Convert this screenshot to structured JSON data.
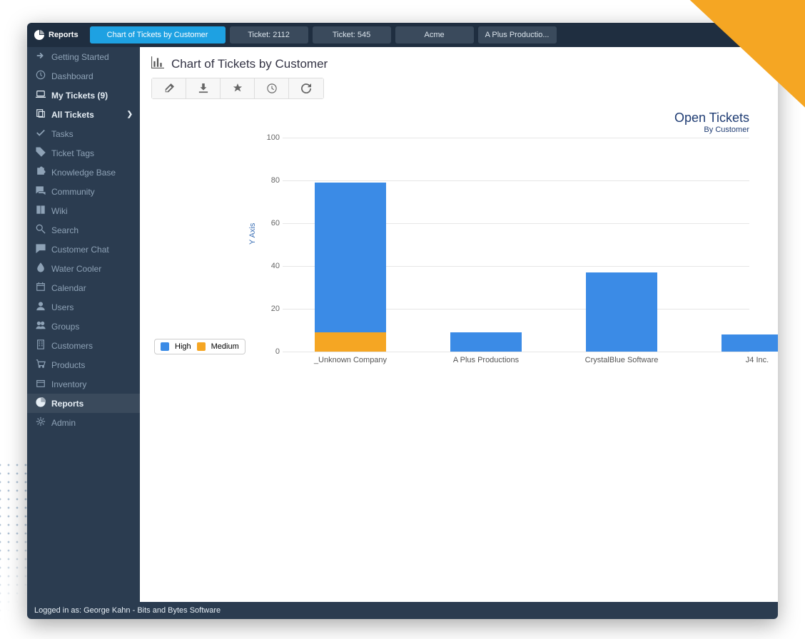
{
  "tabs": [
    {
      "label": "Reports",
      "kind": "main"
    },
    {
      "label": "Chart of Tickets by Customer",
      "active": true
    },
    {
      "label": "Ticket: 2112"
    },
    {
      "label": "Ticket: 545"
    },
    {
      "label": "Acme"
    },
    {
      "label": "A Plus Productio..."
    }
  ],
  "sidebar": {
    "items": [
      {
        "label": "Getting Started",
        "icon": "arrow-right"
      },
      {
        "label": "Dashboard",
        "icon": "clock"
      },
      {
        "label": "My Tickets (9)",
        "icon": "laptop",
        "highlighted": true
      },
      {
        "label": "All Tickets",
        "icon": "copy",
        "highlighted": true,
        "expand": true
      },
      {
        "label": "Tasks",
        "icon": "check"
      },
      {
        "label": "Ticket Tags",
        "icon": "tag"
      },
      {
        "label": "Knowledge Base",
        "icon": "puzzle"
      },
      {
        "label": "Community",
        "icon": "comments"
      },
      {
        "label": "Wiki",
        "icon": "book"
      },
      {
        "label": "Search",
        "icon": "search"
      },
      {
        "label": "Customer Chat",
        "icon": "chat"
      },
      {
        "label": "Water Cooler",
        "icon": "drop"
      },
      {
        "label": "Calendar",
        "icon": "calendar"
      },
      {
        "label": "Users",
        "icon": "user"
      },
      {
        "label": "Groups",
        "icon": "users"
      },
      {
        "label": "Customers",
        "icon": "building"
      },
      {
        "label": "Products",
        "icon": "cart"
      },
      {
        "label": "Inventory",
        "icon": "box"
      },
      {
        "label": "Reports",
        "icon": "pie",
        "active": true,
        "highlighted": true
      },
      {
        "label": "Admin",
        "icon": "gear"
      }
    ]
  },
  "page": {
    "title": "Chart of Tickets by Customer",
    "ylabel": "Y Axis"
  },
  "footer": {
    "text": "Logged in as: George Kahn - Bits and Bytes Software"
  },
  "chart_data": {
    "type": "bar",
    "stacked": true,
    "title": "Open Tickets",
    "subtitle": "By Customer",
    "ylabel": "Y Axis",
    "ylim": [
      0,
      100
    ],
    "yticks": [
      0,
      20,
      40,
      60,
      80,
      100
    ],
    "categories": [
      "_Unknown Company",
      "A Plus Productions",
      "CrystalBlue Software",
      "J4 Inc."
    ],
    "series": [
      {
        "name": "High",
        "color": "#3b8be6",
        "values": [
          70,
          9,
          37,
          8
        ]
      },
      {
        "name": "Medium",
        "color": "#f5a623",
        "values": [
          9,
          0,
          0,
          0
        ]
      }
    ],
    "legend_position": "left"
  }
}
